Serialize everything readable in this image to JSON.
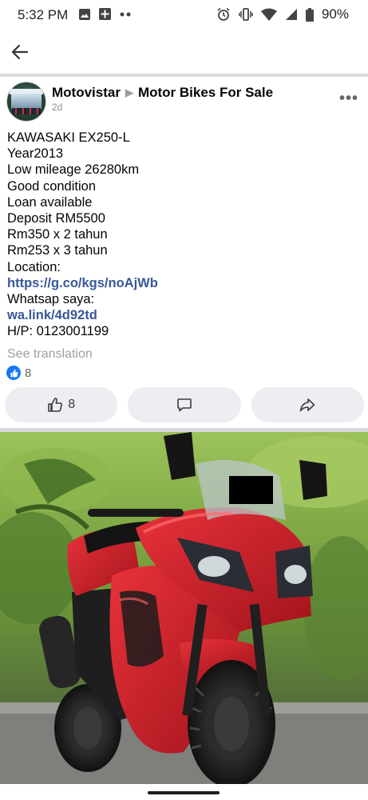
{
  "status_bar": {
    "time": "5:32 PM",
    "battery": "90%"
  },
  "post": {
    "author": "Motovistar",
    "group": "Motor Bikes For Sale",
    "time_ago": "2d",
    "lines": [
      "KAWASAKI EX250-L",
      "Year2013",
      "Low mileage 26280km",
      "Good condition",
      "Loan available",
      "Deposit RM5500",
      "Rm350 x 2 tahun",
      "Rm253 x 3 tahun",
      "Location:"
    ],
    "location_link": "https://g.co/kgs/noAjWb",
    "whatsapp_label": "Whatsap saya:",
    "whatsapp_link": "wa.link/4d92td",
    "phone": "H/P: 0123001199",
    "see_translation": "See translation",
    "reaction_count": "8",
    "like_button_count": "8"
  },
  "icons": {
    "back": "arrow-left-icon",
    "more": "more-dots-icon",
    "like": "thumbs-up-icon",
    "comment": "comment-icon",
    "share": "share-icon"
  },
  "colors": {
    "link": "#385898",
    "like_blue": "#1877f2",
    "button_bg": "#eceef1"
  }
}
